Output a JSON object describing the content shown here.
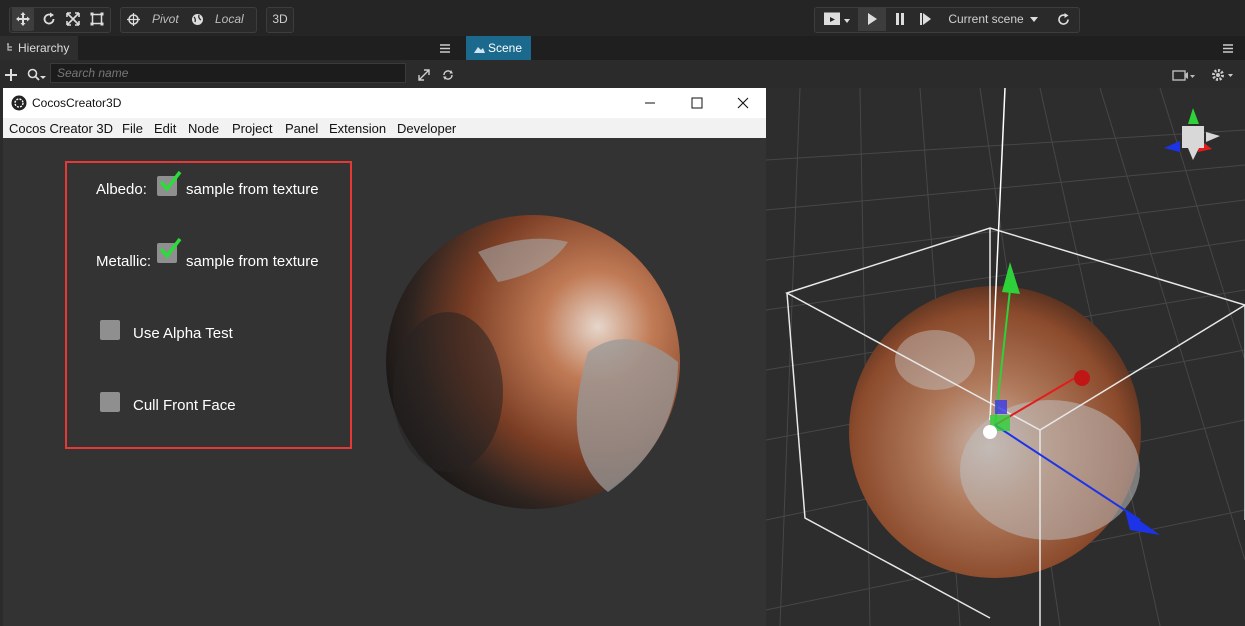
{
  "toolbar": {
    "pivot_label": "Pivot",
    "local_label": "Local",
    "mode_3d": "3D",
    "current_scene": "Current scene",
    "icons": [
      "move-icon",
      "rotate-icon",
      "scale-icon",
      "rect-icon",
      "pivot-icon",
      "local-globe-icon",
      "camera-dropdown-icon",
      "play-icon",
      "pause-icon",
      "step-icon",
      "refresh-icon"
    ]
  },
  "hierarchy": {
    "tab_label": "Hierarchy",
    "search_placeholder": "Search name"
  },
  "scene": {
    "tab_label": "Scene"
  },
  "preview_window": {
    "title": "CocosCreator3D",
    "menu": [
      "Cocos Creator 3D",
      "File",
      "Edit",
      "Node",
      "Project",
      "Panel",
      "Extension",
      "Developer"
    ],
    "options": [
      {
        "label": "Albedo:",
        "checked": true,
        "suffix": "sample from texture"
      },
      {
        "label": "Metallic:",
        "checked": true,
        "suffix": "sample from texture"
      },
      {
        "label": "Use Alpha Test",
        "checked": false
      },
      {
        "label": "Cull Front Face",
        "checked": false
      }
    ]
  },
  "colors": {
    "highlight_box": "#e53935",
    "scene_tab": "#1b6a8e",
    "check_green": "#2bdc3b"
  }
}
